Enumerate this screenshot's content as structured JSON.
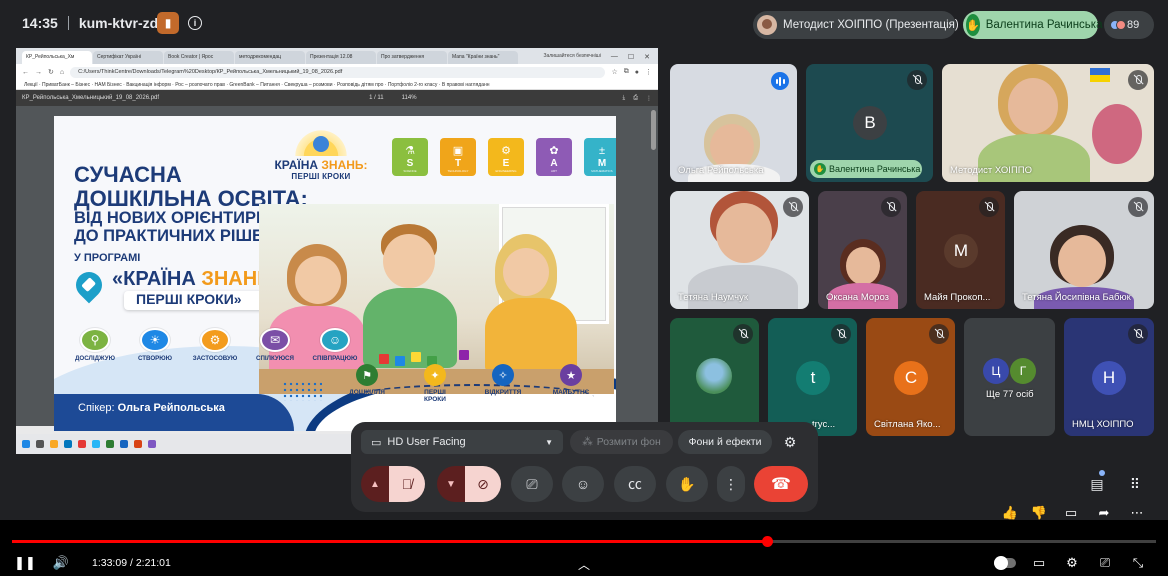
{
  "meeting": {
    "time": "14:35",
    "code": "kum-ktvr-zdb",
    "presenter_label": "Методист ХОІППО (Презентація)",
    "raised_hand_name": "Валентина Рачинська",
    "participant_count": "89"
  },
  "browser": {
    "tabs": [
      "КР_Рейпольська_Хм",
      "Сертифікат Україні",
      "Book Creator | Ярос",
      "методрекомендац",
      "Презентація 12.08",
      "Про затвердження",
      "Мапа \"Країни знань\""
    ],
    "translate_label": "Залишайтеся безпечніші",
    "url": "C:/Users/ThinkCentre/Downloads/Telegram%20Desktop/КР_Рейпольська_Хмельницький_19_08_2026.pdf",
    "bookmarks": "Лекції · ПриватБанк – Бізнес · НАМ Бізнес · Вакцинація інформ · Рос – розпочато прав · GreenBank – Питання · Свекруша – розмови · Розповідь дітям про · Портфоліо 2-го класу · В правові нагляданн",
    "pdf_filename": "КР_Рейпольська_Хмельницький_19_08_2026.pdf",
    "pdf_page": "1 / 11",
    "pdf_zoom": "114%"
  },
  "slide": {
    "title_line1": "СУЧАСНА",
    "title_line2": "ДОШКІЛЬНА ОСВІТА:",
    "title_line3": "ВІД НОВИХ ОРІЄНТИРІВ",
    "title_line4": "ДО ПРАКТИЧНИХ РІШЕНЬ",
    "program_label": "У ПРОГРАМІ",
    "program_name_open": "«",
    "program_name_a": "КРАЇНА",
    "program_name_b": "ЗНАНЬ",
    "program_name_close": ":",
    "program_sub": "ПЕРШІ КРОКИ»",
    "logo_title_a": "КРАЇНА",
    "logo_title_b": "ЗНАНЬ:",
    "logo_sub": "ПЕРШІ КРОКИ",
    "steam": [
      {
        "letter": "S",
        "word": "SCIENCE",
        "color": "#8bbf3f",
        "icon": "⚗"
      },
      {
        "letter": "T",
        "word": "TECHNOLOGY",
        "color": "#f0a51a",
        "icon": "▣"
      },
      {
        "letter": "E",
        "word": "ENGINEERING",
        "color": "#f3b81c",
        "icon": "⚙"
      },
      {
        "letter": "A",
        "word": "ART",
        "color": "#8e5bb5",
        "icon": "✿"
      },
      {
        "letter": "M",
        "word": "MATHEMATICS",
        "color": "#35b3c9",
        "icon": "±"
      }
    ],
    "skills": [
      {
        "label": "ДОСЛІДЖУЮ",
        "color": "#7cb342",
        "icon": "⚲"
      },
      {
        "label": "СТВОРЮЮ",
        "color": "#1e88e5",
        "icon": "☀"
      },
      {
        "label": "ЗАСТОСОВУЮ",
        "color": "#f39c1e",
        "icon": "⚙"
      },
      {
        "label": "СПІЛКУЮСЯ",
        "color": "#7b4fa6",
        "icon": "✉"
      },
      {
        "label": "СПІВПРАЦЮЮ",
        "color": "#26a3c2",
        "icon": "☺"
      }
    ],
    "journey": [
      {
        "label": "ДОШКІЛЛЯ",
        "color": "#2e7d32",
        "icon": "⚑"
      },
      {
        "label": "ПЕРШІ\nКРОКИ",
        "color": "#f3b81c",
        "icon": "✦"
      },
      {
        "label": "ВІДКРИТТЯ",
        "color": "#1565c0",
        "icon": "✧"
      },
      {
        "label": "МАЙБУТНЄ",
        "color": "#6a3fa0",
        "icon": "★"
      }
    ],
    "speaker_label": "Спікер:",
    "speaker_name": "Ольга Рейпольська"
  },
  "participants": [
    {
      "name": "Ольга Рейпольська",
      "speaking": true
    },
    {
      "name": "Валентина Рачинська",
      "initial": "В",
      "hand_raised": true,
      "avatar_color": "#1d5e66"
    },
    {
      "name": "Методист ХОІППО"
    },
    {
      "name": "Тетяна Наумчук"
    },
    {
      "name": "Оксана Мороз"
    },
    {
      "name": "Майя Прокоп...",
      "initial": "М",
      "avatar_color": "#5a3a2c"
    },
    {
      "name": "Тетяна Йосипівна Бабюк"
    },
    {
      "name": ""
    },
    {
      "name": "trус...",
      "initial": "t",
      "avatar_color": "#137d72"
    },
    {
      "name": "Світлана Яко...",
      "initial": "С",
      "avatar_color": "#e8711a"
    },
    {
      "name": "Ще 77 осіб",
      "initials": [
        "Ц",
        "Г"
      ]
    },
    {
      "name": "НМЦ ХОІППО",
      "initial": "Н",
      "avatar_color": "#3f51b5"
    }
  ],
  "controls": {
    "camera_select": "HD User Facing",
    "blur_label": "Розмити фон",
    "effects_label": "Фони й ефекти"
  },
  "player": {
    "current_time": "1:33:09",
    "duration": "2:21:01",
    "time_separator": " / ",
    "progress": 0.66
  }
}
